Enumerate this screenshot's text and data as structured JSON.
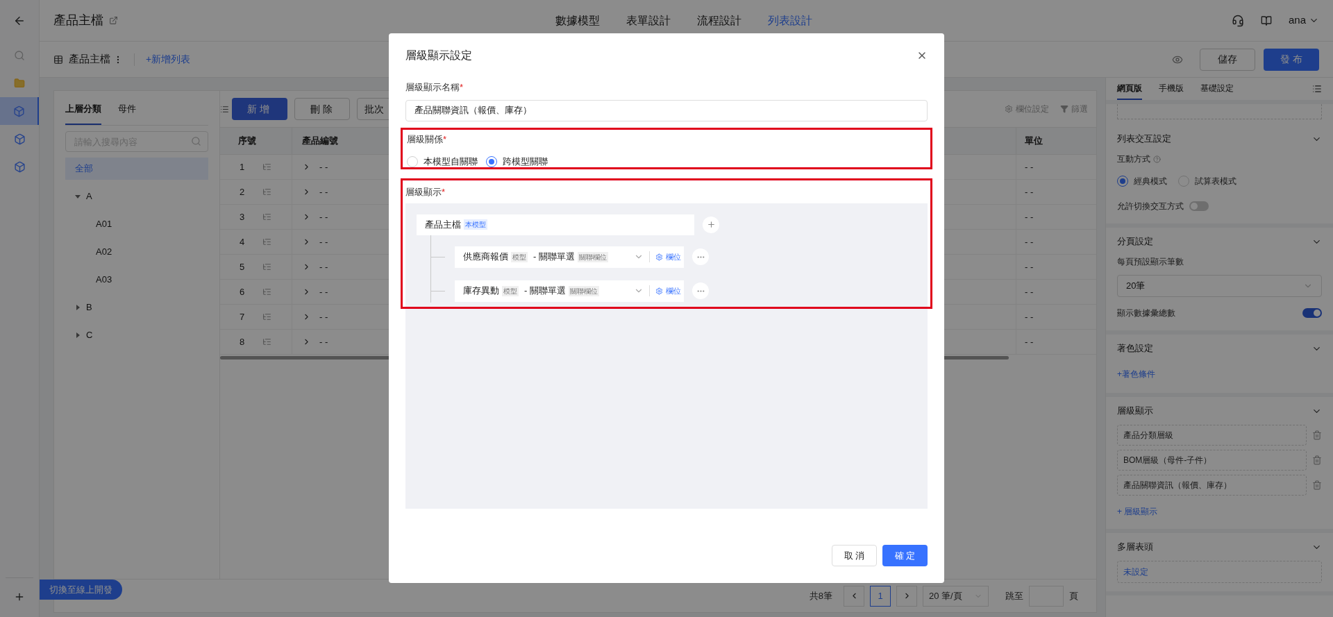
{
  "top_bar": {
    "title": "產品主檔",
    "tabs": [
      {
        "label": "數據模型",
        "selected": false
      },
      {
        "label": "表單設計",
        "selected": false
      },
      {
        "label": "流程設計",
        "selected": false
      },
      {
        "label": "列表設計",
        "selected": true
      }
    ],
    "user": "ana"
  },
  "list_bar": {
    "title": "產品主檔",
    "add_link": "+新增列表",
    "buttons": [
      {
        "label": "儲存",
        "kind": "default"
      },
      {
        "label": "發 布",
        "kind": "primary"
      }
    ]
  },
  "nav_rail": {
    "items": [
      {
        "kind": "search",
        "selected": false
      },
      {
        "kind": "folder",
        "selected": false
      },
      {
        "kind": "model",
        "selected": true
      },
      {
        "kind": "model",
        "selected": false
      },
      {
        "kind": "model",
        "selected": false
      }
    ],
    "switch_button": "切換至線上開發"
  },
  "tree_panel": {
    "tabs": [
      {
        "label": "上層分類",
        "selected": true
      },
      {
        "label": "母件",
        "selected": false
      }
    ],
    "search": {
      "placeholder": "請輸入搜尋內容"
    },
    "tree": [
      {
        "label": "全部",
        "selected": true
      },
      {
        "label": "A",
        "selected": false,
        "expanded": true,
        "children": [
          {
            "label": "A01",
            "selected": false
          },
          {
            "label": "A02",
            "selected": false
          },
          {
            "label": "A03",
            "selected": false
          }
        ]
      },
      {
        "label": "B",
        "selected": false,
        "expanded": false
      },
      {
        "label": "C",
        "selected": false,
        "expanded": false
      }
    ]
  },
  "table": {
    "buttons": [
      {
        "label": "新 增",
        "kind": "primary"
      },
      {
        "label": "刪 除",
        "kind": "default"
      },
      {
        "label": "批次",
        "kind": "default"
      }
    ],
    "tools": [
      {
        "kind": "columns",
        "label": "欄位設定"
      },
      {
        "kind": "filter",
        "label": "篩選"
      }
    ],
    "columns": [
      "序號",
      "產品編號",
      "單位"
    ],
    "rows": [
      {
        "cells": [
          "1",
          "- -",
          "- -"
        ]
      },
      {
        "cells": [
          "2",
          "- -",
          "- -"
        ]
      },
      {
        "cells": [
          "3",
          "- -",
          "- -"
        ]
      },
      {
        "cells": [
          "4",
          "- -",
          "- -"
        ]
      },
      {
        "cells": [
          "5",
          "- -",
          "- -"
        ]
      },
      {
        "cells": [
          "6",
          "- -",
          "- -"
        ]
      },
      {
        "cells": [
          "7",
          "- -",
          "- -"
        ]
      },
      {
        "cells": [
          "8",
          "- -",
          "- -"
        ]
      }
    ]
  },
  "pagination": {
    "total": "共8筆",
    "current": "1",
    "page_size": "20 筆/頁",
    "jump_label": "跳至",
    "page_unit": "頁"
  },
  "settings_panel": {
    "tabs": [
      {
        "label": "網頁版",
        "selected": true
      },
      {
        "label": "手機版",
        "selected": false
      },
      {
        "label": "基礎設定",
        "selected": false
      }
    ],
    "sections": [
      {
        "kind": "interaction",
        "title": "列表交互設定",
        "mode_label": "互動方式",
        "modes": [
          {
            "label": "經典模式",
            "selected": true
          },
          {
            "label": "試算表模式",
            "selected": false
          }
        ],
        "toggle": {
          "label": "允許切換交互方式",
          "on": false
        }
      },
      {
        "kind": "paging",
        "title": "分頁設定",
        "size_label": "每頁預設顯示筆數",
        "size_value": "20筆",
        "toggle": {
          "label": "顯示數據彙總數",
          "on": true
        }
      },
      {
        "kind": "coloring",
        "title": "著色設定",
        "add_link": "+著色條件"
      },
      {
        "kind": "levels",
        "title": "層級顯示",
        "items": [
          "產品分類層級",
          "BOM層級（母件-子件）",
          "產品關聯資訊（報價、庫存）"
        ],
        "add_link": "+ 層級顯示"
      },
      {
        "kind": "headers",
        "title": "多層表頭",
        "value": "未設定"
      }
    ]
  },
  "dialog": {
    "title": "層級顯示設定",
    "name_field": {
      "label": "層級顯示名稱",
      "required_mark": "*",
      "value": "產品關聯資訊（報價、庫存）"
    },
    "relation": {
      "label": "層級關係",
      "required_mark": "*",
      "highlighted": true,
      "options": [
        {
          "label": "本模型自關聯",
          "selected": false
        },
        {
          "label": "跨模型關聯",
          "selected": true
        }
      ]
    },
    "display": {
      "label": "層級顯示",
      "required_mark": "*",
      "highlighted": true,
      "root": {
        "label": "產品主檔",
        "tag": "本模型"
      },
      "children": [
        {
          "model": "供應商報價",
          "model_tag": "模型",
          "field": "- 關聯單選",
          "field_tag": "關聯欄位",
          "fields_link": "欄位"
        },
        {
          "model": "庫存異動",
          "model_tag": "模型",
          "field": "- 關聯單選",
          "field_tag": "關聯欄位",
          "fields_link": "欄位"
        }
      ]
    },
    "buttons": [
      {
        "label": "取 消",
        "kind": "default"
      },
      {
        "label": "確 定",
        "kind": "primary"
      }
    ]
  }
}
